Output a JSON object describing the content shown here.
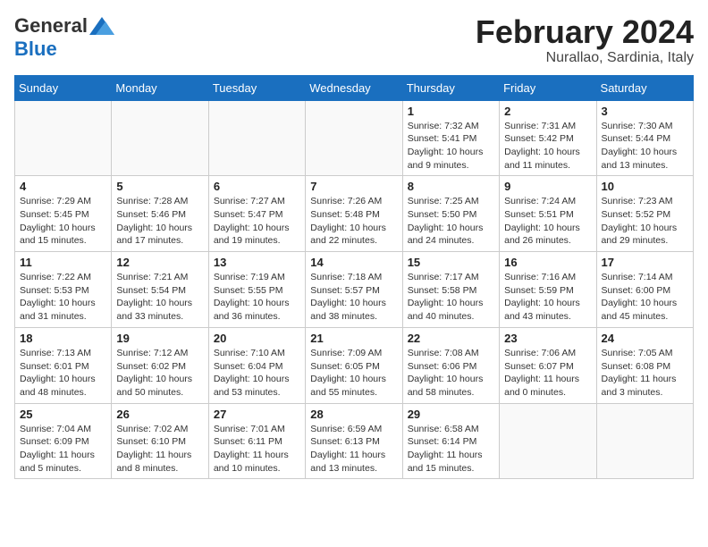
{
  "header": {
    "logo_general": "General",
    "logo_blue": "Blue",
    "month_year": "February 2024",
    "location": "Nurallao, Sardinia, Italy"
  },
  "weekdays": [
    "Sunday",
    "Monday",
    "Tuesday",
    "Wednesday",
    "Thursday",
    "Friday",
    "Saturday"
  ],
  "weeks": [
    [
      {
        "day": "",
        "info": ""
      },
      {
        "day": "",
        "info": ""
      },
      {
        "day": "",
        "info": ""
      },
      {
        "day": "",
        "info": ""
      },
      {
        "day": "1",
        "info": "Sunrise: 7:32 AM\nSunset: 5:41 PM\nDaylight: 10 hours\nand 9 minutes."
      },
      {
        "day": "2",
        "info": "Sunrise: 7:31 AM\nSunset: 5:42 PM\nDaylight: 10 hours\nand 11 minutes."
      },
      {
        "day": "3",
        "info": "Sunrise: 7:30 AM\nSunset: 5:44 PM\nDaylight: 10 hours\nand 13 minutes."
      }
    ],
    [
      {
        "day": "4",
        "info": "Sunrise: 7:29 AM\nSunset: 5:45 PM\nDaylight: 10 hours\nand 15 minutes."
      },
      {
        "day": "5",
        "info": "Sunrise: 7:28 AM\nSunset: 5:46 PM\nDaylight: 10 hours\nand 17 minutes."
      },
      {
        "day": "6",
        "info": "Sunrise: 7:27 AM\nSunset: 5:47 PM\nDaylight: 10 hours\nand 19 minutes."
      },
      {
        "day": "7",
        "info": "Sunrise: 7:26 AM\nSunset: 5:48 PM\nDaylight: 10 hours\nand 22 minutes."
      },
      {
        "day": "8",
        "info": "Sunrise: 7:25 AM\nSunset: 5:50 PM\nDaylight: 10 hours\nand 24 minutes."
      },
      {
        "day": "9",
        "info": "Sunrise: 7:24 AM\nSunset: 5:51 PM\nDaylight: 10 hours\nand 26 minutes."
      },
      {
        "day": "10",
        "info": "Sunrise: 7:23 AM\nSunset: 5:52 PM\nDaylight: 10 hours\nand 29 minutes."
      }
    ],
    [
      {
        "day": "11",
        "info": "Sunrise: 7:22 AM\nSunset: 5:53 PM\nDaylight: 10 hours\nand 31 minutes."
      },
      {
        "day": "12",
        "info": "Sunrise: 7:21 AM\nSunset: 5:54 PM\nDaylight: 10 hours\nand 33 minutes."
      },
      {
        "day": "13",
        "info": "Sunrise: 7:19 AM\nSunset: 5:55 PM\nDaylight: 10 hours\nand 36 minutes."
      },
      {
        "day": "14",
        "info": "Sunrise: 7:18 AM\nSunset: 5:57 PM\nDaylight: 10 hours\nand 38 minutes."
      },
      {
        "day": "15",
        "info": "Sunrise: 7:17 AM\nSunset: 5:58 PM\nDaylight: 10 hours\nand 40 minutes."
      },
      {
        "day": "16",
        "info": "Sunrise: 7:16 AM\nSunset: 5:59 PM\nDaylight: 10 hours\nand 43 minutes."
      },
      {
        "day": "17",
        "info": "Sunrise: 7:14 AM\nSunset: 6:00 PM\nDaylight: 10 hours\nand 45 minutes."
      }
    ],
    [
      {
        "day": "18",
        "info": "Sunrise: 7:13 AM\nSunset: 6:01 PM\nDaylight: 10 hours\nand 48 minutes."
      },
      {
        "day": "19",
        "info": "Sunrise: 7:12 AM\nSunset: 6:02 PM\nDaylight: 10 hours\nand 50 minutes."
      },
      {
        "day": "20",
        "info": "Sunrise: 7:10 AM\nSunset: 6:04 PM\nDaylight: 10 hours\nand 53 minutes."
      },
      {
        "day": "21",
        "info": "Sunrise: 7:09 AM\nSunset: 6:05 PM\nDaylight: 10 hours\nand 55 minutes."
      },
      {
        "day": "22",
        "info": "Sunrise: 7:08 AM\nSunset: 6:06 PM\nDaylight: 10 hours\nand 58 minutes."
      },
      {
        "day": "23",
        "info": "Sunrise: 7:06 AM\nSunset: 6:07 PM\nDaylight: 11 hours\nand 0 minutes."
      },
      {
        "day": "24",
        "info": "Sunrise: 7:05 AM\nSunset: 6:08 PM\nDaylight: 11 hours\nand 3 minutes."
      }
    ],
    [
      {
        "day": "25",
        "info": "Sunrise: 7:04 AM\nSunset: 6:09 PM\nDaylight: 11 hours\nand 5 minutes."
      },
      {
        "day": "26",
        "info": "Sunrise: 7:02 AM\nSunset: 6:10 PM\nDaylight: 11 hours\nand 8 minutes."
      },
      {
        "day": "27",
        "info": "Sunrise: 7:01 AM\nSunset: 6:11 PM\nDaylight: 11 hours\nand 10 minutes."
      },
      {
        "day": "28",
        "info": "Sunrise: 6:59 AM\nSunset: 6:13 PM\nDaylight: 11 hours\nand 13 minutes."
      },
      {
        "day": "29",
        "info": "Sunrise: 6:58 AM\nSunset: 6:14 PM\nDaylight: 11 hours\nand 15 minutes."
      },
      {
        "day": "",
        "info": ""
      },
      {
        "day": "",
        "info": ""
      }
    ]
  ]
}
